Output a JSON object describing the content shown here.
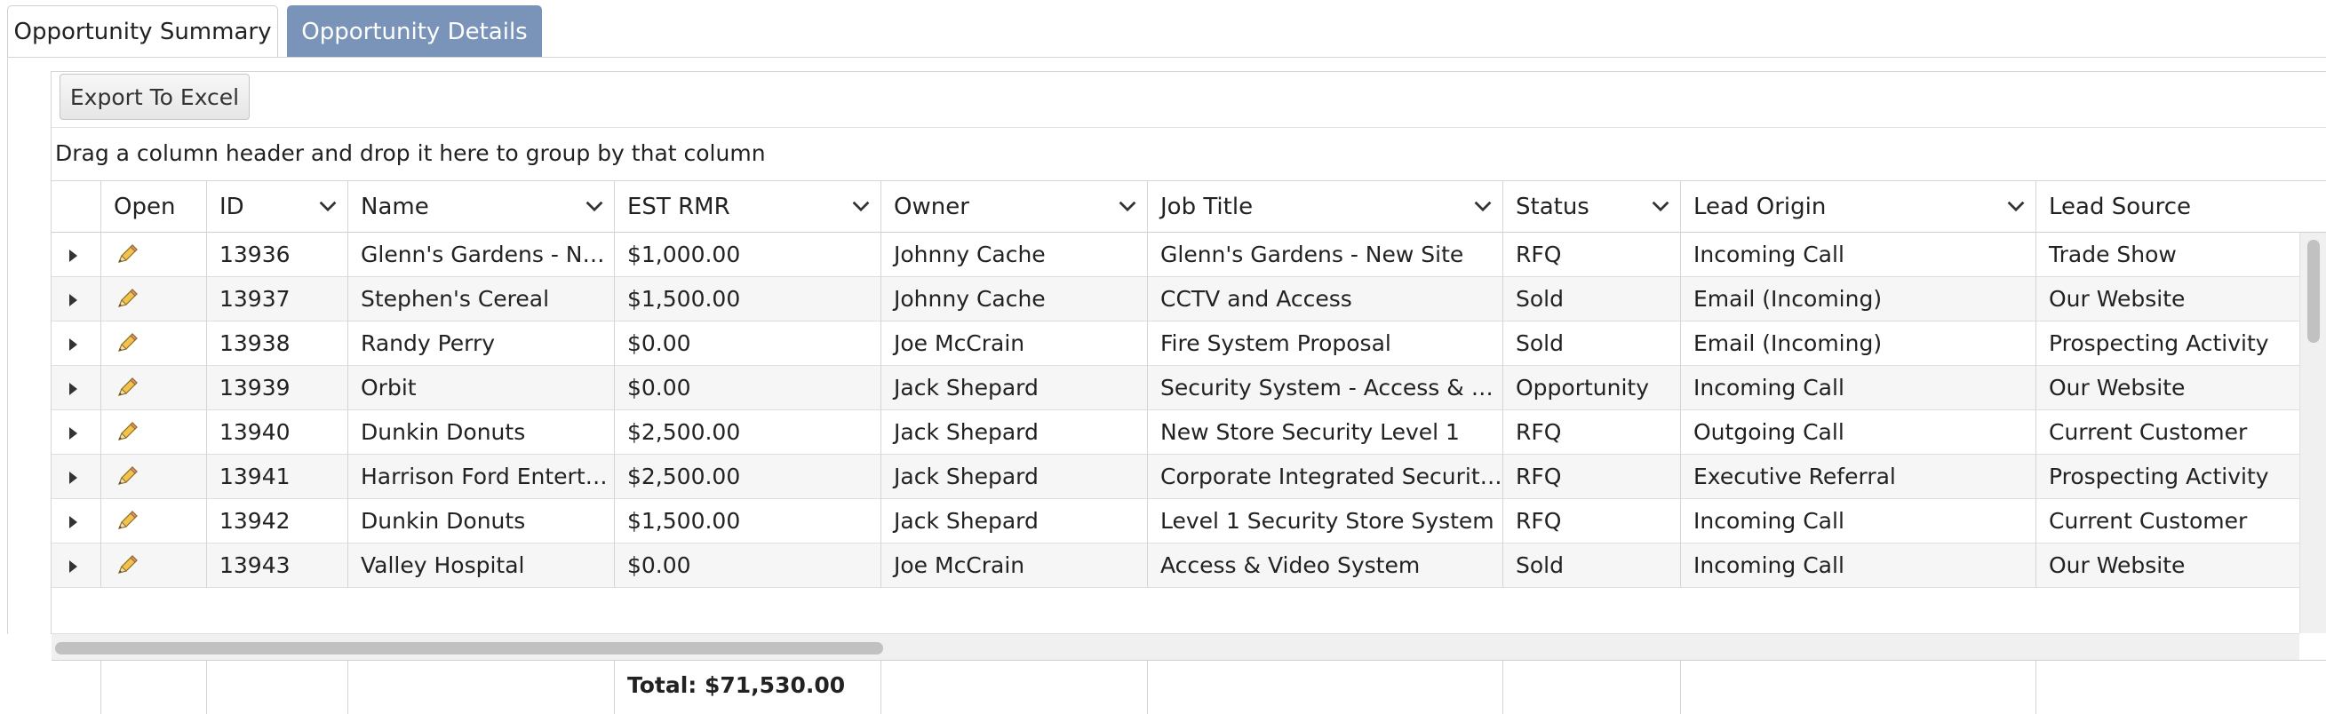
{
  "tabs": [
    "Opportunity Summary",
    "Opportunity Details"
  ],
  "toolbar": {
    "export_label": "Export To Excel"
  },
  "group_panel": "Drag a column header and drop it here to group by that column",
  "columns": [
    "",
    "Open",
    "ID",
    "Name",
    "EST RMR",
    "Owner",
    "Job Title",
    "Status",
    "Lead Origin",
    "Lead Source"
  ],
  "rows": [
    {
      "id": "13936",
      "name": "Glenn's Gardens - New Site",
      "est_rmr": "$1,000.00",
      "owner": "Johnny Cache",
      "job_title": "Glenn's Gardens - New Site",
      "status": "RFQ",
      "lead_origin": "Incoming Call",
      "lead_source": "Trade Show"
    },
    {
      "id": "13937",
      "name": "Stephen's Cereal",
      "est_rmr": "$1,500.00",
      "owner": "Johnny Cache",
      "job_title": "CCTV and Access",
      "status": "Sold",
      "lead_origin": "Email (Incoming)",
      "lead_source": "Our Website"
    },
    {
      "id": "13938",
      "name": "Randy Perry",
      "est_rmr": "$0.00",
      "owner": "Joe McCrain",
      "job_title": "Fire System Proposal",
      "status": "Sold",
      "lead_origin": "Email (Incoming)",
      "lead_source": "Prospecting Activity"
    },
    {
      "id": "13939",
      "name": "Orbit",
      "est_rmr": "$0.00",
      "owner": "Jack Shepard",
      "job_title": "Security System - Access & Video",
      "status": "Opportunity",
      "lead_origin": "Incoming Call",
      "lead_source": "Our Website"
    },
    {
      "id": "13940",
      "name": "Dunkin Donuts",
      "est_rmr": "$2,500.00",
      "owner": "Jack Shepard",
      "job_title": "New Store Security Level 1",
      "status": "RFQ",
      "lead_origin": "Outgoing Call",
      "lead_source": "Current Customer"
    },
    {
      "id": "13941",
      "name": "Harrison Ford Entertainment",
      "est_rmr": "$2,500.00",
      "owner": "Jack Shepard",
      "job_title": "Corporate Integrated Security System",
      "status": "RFQ",
      "lead_origin": "Executive Referral",
      "lead_source": "Prospecting Activity"
    },
    {
      "id": "13942",
      "name": "Dunkin Donuts",
      "est_rmr": "$1,500.00",
      "owner": "Jack Shepard",
      "job_title": "Level 1 Security Store System",
      "status": "RFQ",
      "lead_origin": "Incoming Call",
      "lead_source": "Current Customer"
    },
    {
      "id": "13943",
      "name": "Valley Hospital",
      "est_rmr": "$0.00",
      "owner": "Joe McCrain",
      "job_title": "Access & Video System",
      "status": "Sold",
      "lead_origin": "Incoming Call",
      "lead_source": "Our Website"
    }
  ],
  "footer": {
    "total": "Total: $71,530.00"
  },
  "colors": {
    "active_tab": "#7a93b8",
    "row_alt": "#f6f6f6",
    "border": "#d5d5d5"
  },
  "icons": {
    "expand": "triangle-right-icon",
    "open": "pencil-icon",
    "sort": "chevron-down-icon"
  }
}
